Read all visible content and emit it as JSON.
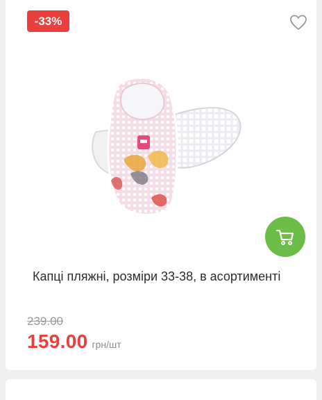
{
  "product": {
    "discount_badge": "-33%",
    "title": "Капці пляжні, розміри 33-38, в асортименті",
    "old_price": "239.00",
    "price": "159.00",
    "unit": "грн/шт",
    "image_alt": "Капці пляжні",
    "wishlist_icon": "heart-icon",
    "cart_icon": "cart-icon"
  },
  "colors": {
    "badge": "#e8403c",
    "price": "#e8403c",
    "cart_button": "#6bbd47"
  }
}
